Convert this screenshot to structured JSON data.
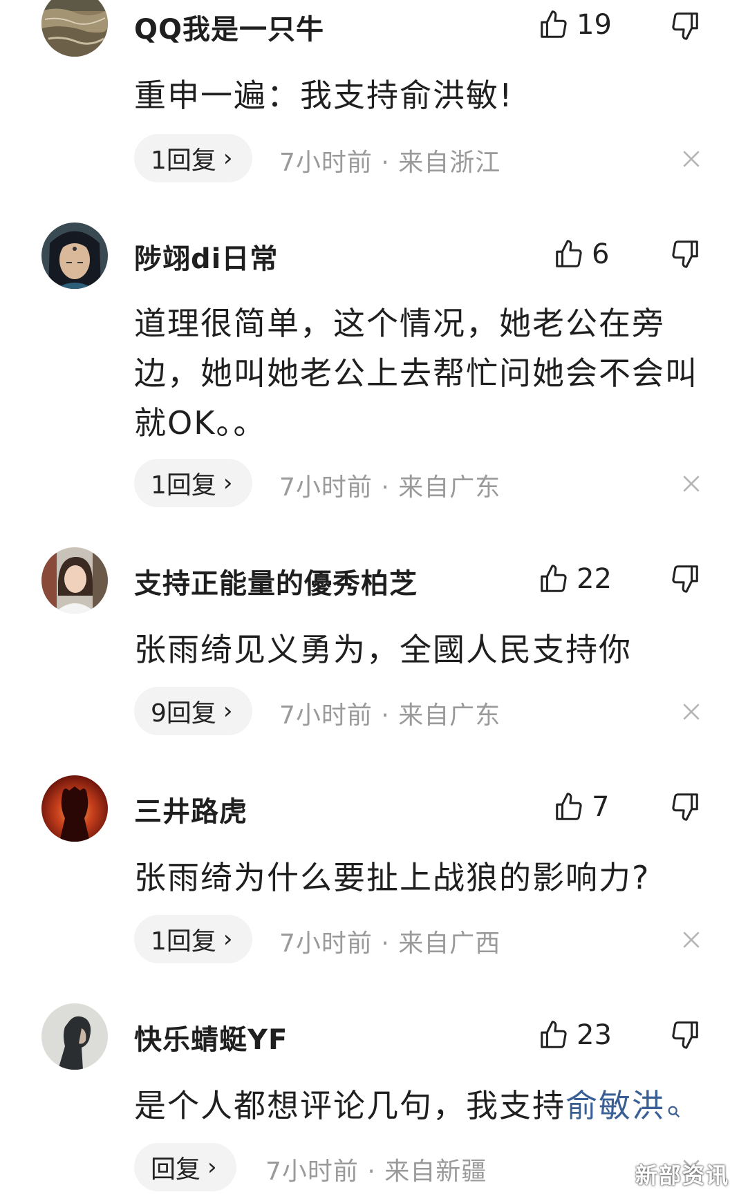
{
  "comments": [
    {
      "username": "QQ我是一只牛",
      "likes": "19",
      "text": "重申一遍：我支持俞洪敏!",
      "reply_label": "1回复",
      "meta": "7小时前 · 来自浙江",
      "avatar": "landscape-avatar"
    },
    {
      "username": "陟翊di日常",
      "likes": "6",
      "text": "道理很简单，这个情况，她老公在旁边，她叫她老公上去帮忙问她会不会叫就OK。。",
      "reply_label": "1回复",
      "meta": "7小时前 · 来自广东",
      "avatar": "anime-character-avatar"
    },
    {
      "username": "支持正能量的優秀柏芝",
      "likes": "22",
      "text": "张雨绮见义勇为，全國人民支持你",
      "reply_label": "9回复",
      "meta": "7小时前 · 来自广东",
      "avatar": "woman-photo-avatar"
    },
    {
      "username": "三井路虎",
      "likes": "7",
      "text": "张雨绮为什么要扯上战狼的影响力?",
      "reply_label": "1回复",
      "meta": "7小时前 · 来自广西",
      "avatar": "red-silhouette-avatar"
    },
    {
      "username": "快乐蜻蜓YF",
      "likes": "23",
      "text_prefix": "是个人都想评论几句，我支持",
      "text_link": "俞敏洪",
      "reply_label": "回复",
      "meta": "7小时前 · 来自新疆",
      "avatar": "man-profile-avatar"
    }
  ],
  "icons": {
    "like": "thumbs-up-icon",
    "dislike": "thumbs-down-icon",
    "close": "close-icon",
    "search": "search-icon"
  },
  "reply_chevron": "›",
  "watermark": "新部资讯",
  "colors": {
    "link": "#3a5f95",
    "meta": "#9a9a9a",
    "reply_bg": "#f3f3f3"
  }
}
